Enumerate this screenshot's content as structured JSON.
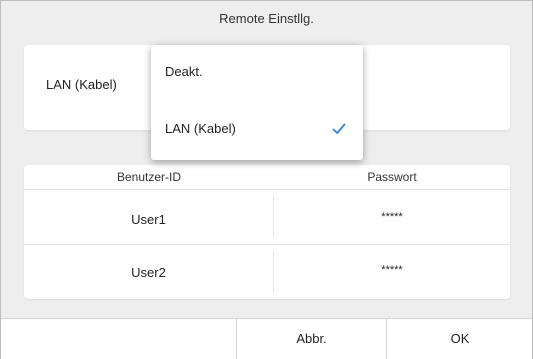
{
  "dialog": {
    "title": "Remote Einstllg."
  },
  "network": {
    "selected_value": "LAN (Kabel)",
    "dropdown_options": [
      {
        "label": "Deakt.",
        "selected": false
      },
      {
        "label": "LAN (Kabel)",
        "selected": true
      }
    ]
  },
  "users_table": {
    "columns": [
      "Benutzer-ID",
      "Passwort"
    ],
    "rows": [
      {
        "user_id": "User1",
        "password": "*****"
      },
      {
        "user_id": "User2",
        "password": "*****"
      }
    ]
  },
  "footer": {
    "cancel_label": "Abbr.",
    "ok_label": "OK"
  },
  "colors": {
    "accent": "#2f7fe0",
    "background": "#eeeeee",
    "card": "#ffffff"
  },
  "icons": {
    "selected_check": "checkmark-icon"
  }
}
